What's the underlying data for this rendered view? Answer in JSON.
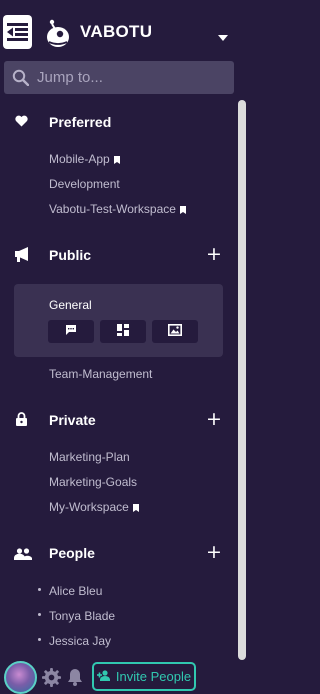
{
  "header": {
    "brand": "VABOTU",
    "collapse_icon": "collapse-sidebar-icon",
    "logo_icon": "bug-logo-icon",
    "caret_icon": "caret-down-icon"
  },
  "search": {
    "placeholder": "Jump to...",
    "value": ""
  },
  "sections": {
    "preferred": {
      "label": "Preferred",
      "icon": "heart-icon",
      "items": [
        {
          "label": "Mobile-App",
          "bookmarked": true
        },
        {
          "label": "Development",
          "bookmarked": false
        },
        {
          "label": "Vabotu-Test-Workspace",
          "bookmarked": true
        }
      ]
    },
    "public": {
      "label": "Public",
      "icon": "megaphone-icon",
      "active_channel": {
        "label": "General",
        "actions": [
          "chat-icon",
          "dashboard-icon",
          "image-icon"
        ]
      },
      "items": [
        {
          "label": "Team-Management"
        }
      ]
    },
    "private": {
      "label": "Private",
      "icon": "lock-icon",
      "items": [
        {
          "label": "Marketing-Plan",
          "bookmarked": false
        },
        {
          "label": "Marketing-Goals",
          "bookmarked": false
        },
        {
          "label": "My-Workspace",
          "bookmarked": true
        }
      ]
    },
    "people": {
      "label": "People",
      "icon": "people-icon",
      "items": [
        {
          "label": "Alice Bleu"
        },
        {
          "label": "Tonya Blade"
        },
        {
          "label": "Jessica Jay"
        }
      ]
    }
  },
  "footer": {
    "invite_label": "Invite People",
    "icons": [
      "avatar",
      "gear-icon",
      "bell-icon",
      "add-person-icon"
    ]
  },
  "colors": {
    "background": "#251b3d",
    "search_bg": "#4b4464",
    "active_card": "#3a3152",
    "muted_text": "#c0bccf",
    "accent": "#31c8b0"
  }
}
